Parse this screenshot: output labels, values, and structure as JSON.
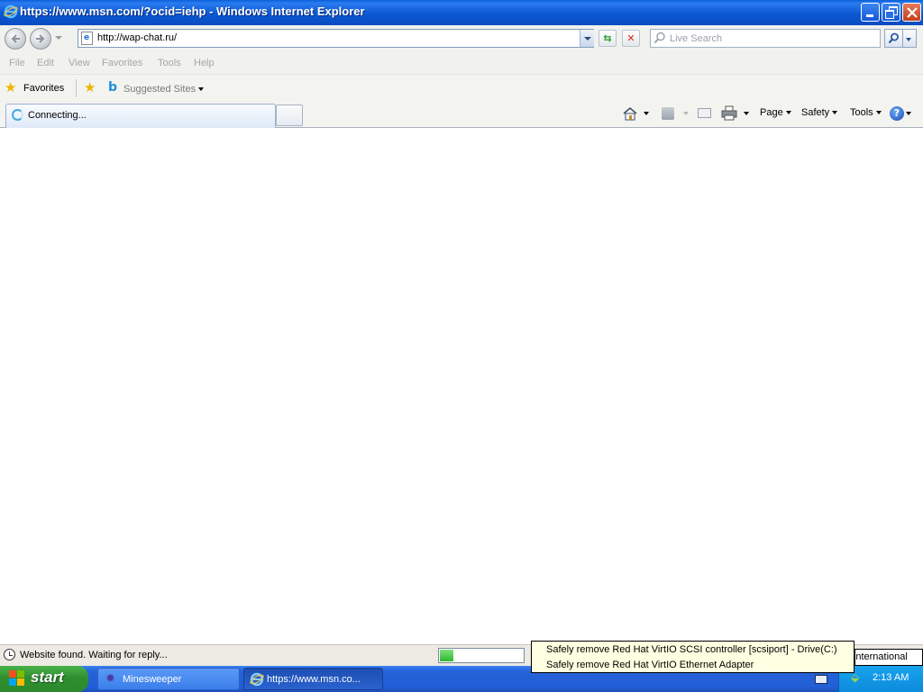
{
  "window": {
    "title": "https://www.msn.com/?ocid=iehp - Windows Internet Explorer"
  },
  "nav": {
    "address": "http://wap-chat.ru/",
    "search_placeholder": "Live Search"
  },
  "menu": {
    "items": [
      "File",
      "Edit",
      "View",
      "Favorites",
      "Tools",
      "Help"
    ]
  },
  "favorites_bar": {
    "favorites_label": "Favorites",
    "suggested_sites_label": "Suggested Sites"
  },
  "tabs": {
    "active_label": "Connecting..."
  },
  "command_bar": {
    "page_label": "Page",
    "safety_label": "Safety",
    "tools_label": "Tools"
  },
  "status": {
    "text": "Website found. Waiting for reply...",
    "progress": 0.16
  },
  "taskbar": {
    "start_label": "start",
    "tasks": [
      "Minesweeper",
      "https://www.msn.co..."
    ],
    "clock": "2:13 AM",
    "language": "es-International"
  },
  "tooltip": {
    "lines": [
      "Safely remove Red Hat VirtIO SCSI controller [scsiport] - Drive(C:)",
      "Safely remove Red Hat VirtIO Ethernet Adapter"
    ]
  },
  "colors": {
    "titlebar": "#0b58d3",
    "taskbar": "#225ed6",
    "start": "#2f8f2f",
    "tooltip_bg": "#ffffe1"
  }
}
